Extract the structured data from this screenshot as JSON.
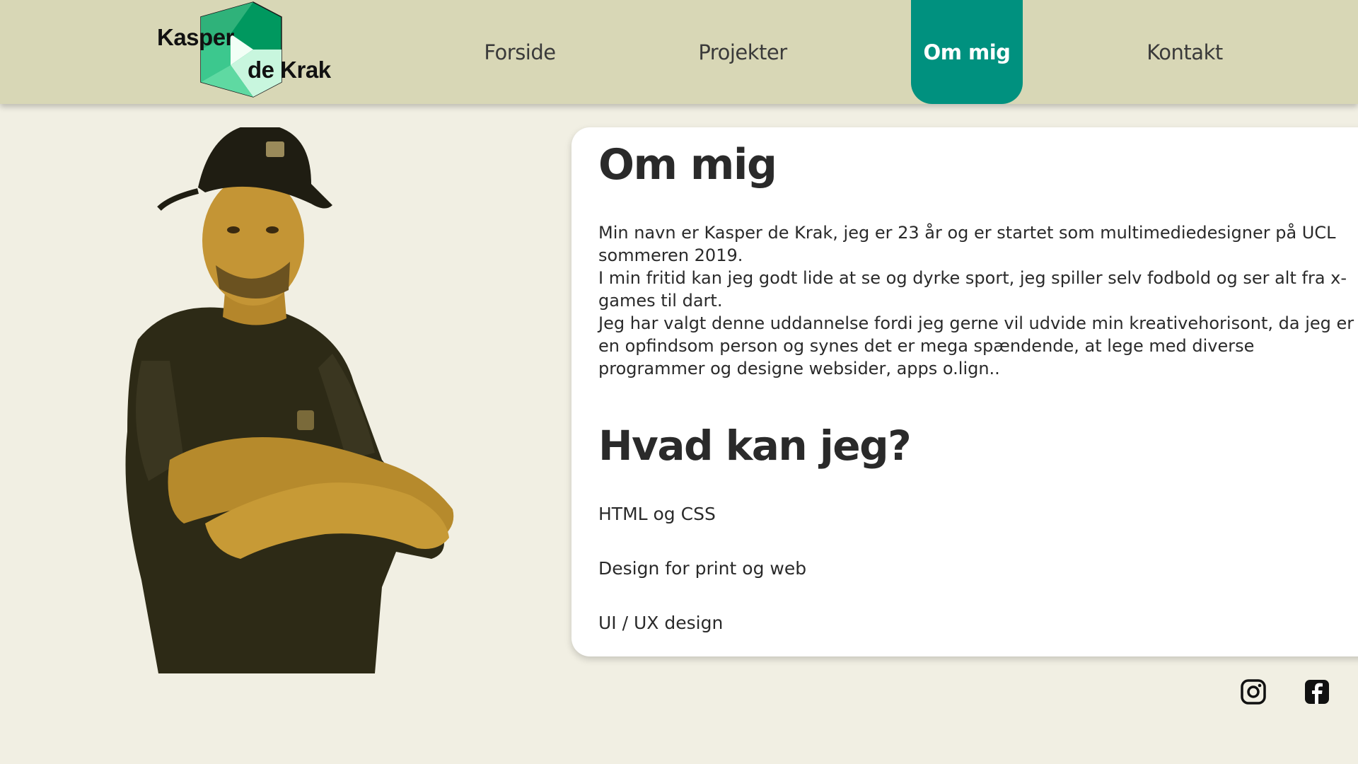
{
  "logo": {
    "line1": "Kasper",
    "line2": "de Krak"
  },
  "nav": {
    "items": [
      {
        "label": "Forside"
      },
      {
        "label": "Projekter"
      },
      {
        "label": "Om mig",
        "active": true
      },
      {
        "label": "Kontakt"
      }
    ]
  },
  "about": {
    "title": "Om mig",
    "paragraphs": [
      "Min navn er Kasper de Krak, jeg er 23 år og er startet som multimediedesigner på UCL sommeren 2019.",
      "I min fritid kan jeg godt lide at se og dyrke sport, jeg spiller selv fodbold og ser alt fra x-games til dart.",
      "Jeg har valgt denne uddannelse fordi jeg gerne vil udvide min kreativehorisont, da jeg er en opfindsom person og synes det er mega spændende, at lege med diverse programmer og designe websider, apps o.lign.."
    ]
  },
  "skills": {
    "title": "Hvad kan jeg?",
    "items": [
      "HTML og CSS",
      "Design for print og web",
      "UI / UX design"
    ]
  },
  "social": {
    "icons": [
      "instagram-icon",
      "facebook-icon"
    ]
  },
  "colors": {
    "header_bg": "#d8d7b6",
    "accent": "#00917f",
    "page_bg": "#f1efe3",
    "card_bg": "#ffffff"
  }
}
